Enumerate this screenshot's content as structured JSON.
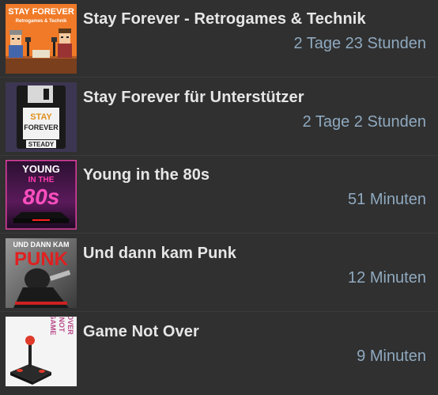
{
  "episodes": [
    {
      "title": "Stay Forever - Retrogames & Technik",
      "duration": "2 Tage 23 Stunden",
      "cover_text": [
        "STAY FOREVER",
        "Retrogames & Technik"
      ]
    },
    {
      "title": "Stay Forever für Unterstützer",
      "duration": "2 Tage 2 Stunden",
      "cover_text": [
        "STAY",
        "FOREVER",
        "STEADY"
      ]
    },
    {
      "title": "Young in the 80s",
      "duration": "51 Minuten",
      "cover_text": [
        "YOUNG",
        "IN THE",
        "80s"
      ]
    },
    {
      "title": "Und dann kam Punk",
      "duration": "12 Minuten",
      "cover_text": [
        "UND DANN KAM",
        "PUNK"
      ]
    },
    {
      "title": "Game Not Over",
      "duration": "9 Minuten",
      "cover_text": [
        "GAME",
        "NOT",
        "OVER"
      ]
    }
  ],
  "colors": {
    "background": "#303030",
    "title": "#e6e6e6",
    "duration": "#8fa9bf"
  }
}
